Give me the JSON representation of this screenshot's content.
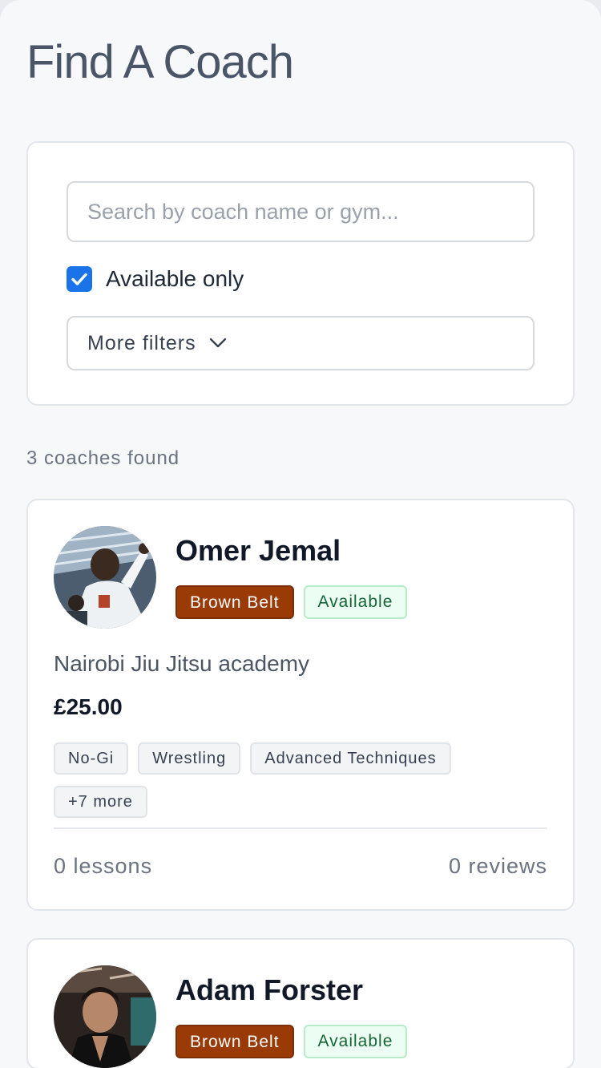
{
  "page": {
    "title": "Find A Coach"
  },
  "filters": {
    "search_placeholder": "Search by coach name or gym...",
    "search_value": "",
    "available_only_label": "Available only",
    "available_only_checked": true,
    "more_filters_label": "More filters"
  },
  "results": {
    "count_text": "3 coaches found"
  },
  "coaches": [
    {
      "name": "Omer Jemal",
      "belt": "Brown Belt",
      "status": "Available",
      "gym": "Nairobi Jiu Jitsu academy",
      "price": "£25.00",
      "tags": [
        "No-Gi",
        "Wrestling",
        "Advanced Techniques",
        "+7 more"
      ],
      "lessons": "0 lessons",
      "reviews": "0 reviews"
    },
    {
      "name": "Adam Forster",
      "belt": "Brown Belt",
      "status": "Available"
    }
  ],
  "colors": {
    "accent": "#1a73e8",
    "belt_brown": "#9a3a06",
    "available_bg": "#ecfdf3",
    "available_text": "#166534"
  },
  "icons": {
    "checkbox": "checkmark-icon",
    "more_filters": "chevron-down-icon",
    "avatar": "coach-photo"
  }
}
